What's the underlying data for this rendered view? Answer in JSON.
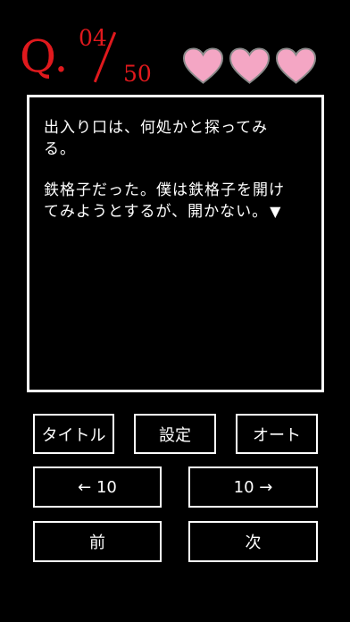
{
  "question": {
    "prefix": "Q.",
    "current": "04",
    "total": "50"
  },
  "lives": {
    "count": 3,
    "color": "#f4a6c4",
    "stroke": "#8a8a8a"
  },
  "message": {
    "line1": "出入り口は、何処かと探ってみ",
    "line2": "る。",
    "line3": "鉄格子だった。僕は鉄格子を開け",
    "line4": "てみようとするが、開かない。",
    "continue_mark": "▼"
  },
  "buttons": {
    "title": "タイトル",
    "settings": "設定",
    "auto": "オート",
    "back10": "← 10",
    "fwd10": "10 →",
    "prev": "前",
    "next": "次"
  },
  "colors": {
    "accent": "#e0191d",
    "background": "#000000",
    "text": "#ffffff"
  }
}
